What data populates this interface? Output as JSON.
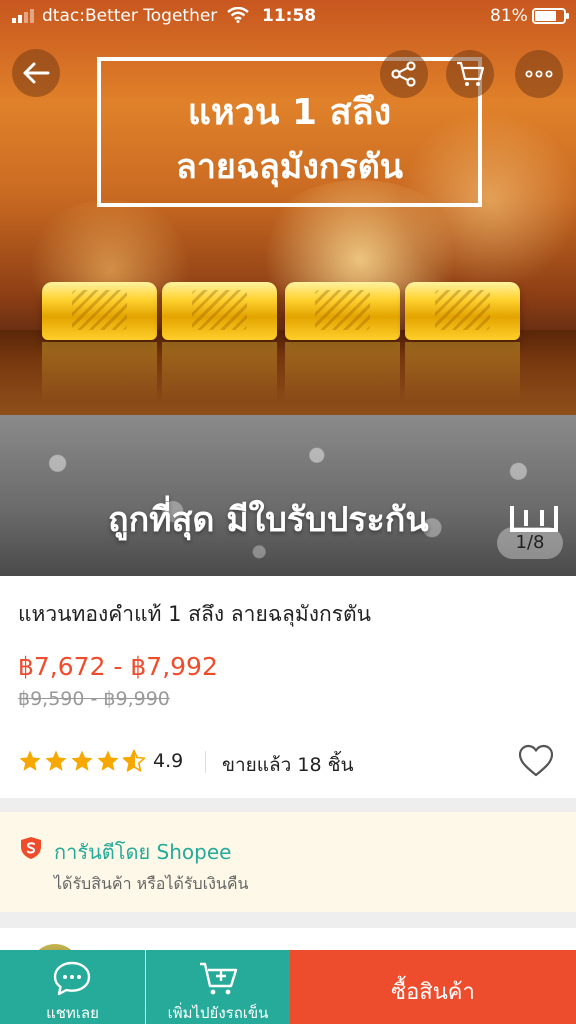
{
  "status_bar": {
    "carrier": "dtac:Better Together",
    "time": "11:58",
    "battery": "81%",
    "battery_level": 0.81
  },
  "top_actions": {
    "back_icon": "arrow-left-icon",
    "share_icon": "share-icon",
    "cart_icon": "cart-icon",
    "more_icon": "more-horizontal-icon"
  },
  "hero": {
    "title_line1": "แหวน 1 สลึง",
    "title_line2": "ลายฉลุมังกรตัน",
    "promo": "ถูกที่สุด มีใบรับประกัน",
    "counter": "1/8"
  },
  "product": {
    "title": "แหวนทองคำแท้ 1 สลึง ลายฉลุมังกรตัน",
    "price": "฿7,672 - ฿7,992",
    "original_price": "฿9,590 - ฿9,990",
    "rating": "4.9",
    "rating_value": 4.9,
    "sold": "ขายแล้ว 18 ชิ้น",
    "accent_color": "#ee4d2d"
  },
  "guarantee": {
    "title": "การันตีโดย Shopee",
    "subtitle": "ได้รับสินค้า หรือได้รับเงินคืน",
    "color": "#26aa99"
  },
  "bottom_bar": {
    "chat_label": "แชทเลย",
    "add_to_cart_label": "เพิ่มไปยังรถเข็น",
    "buy_label": "ซื้อสินค้า",
    "chat_color": "#26aa99",
    "buy_color": "#ee4d2d"
  }
}
